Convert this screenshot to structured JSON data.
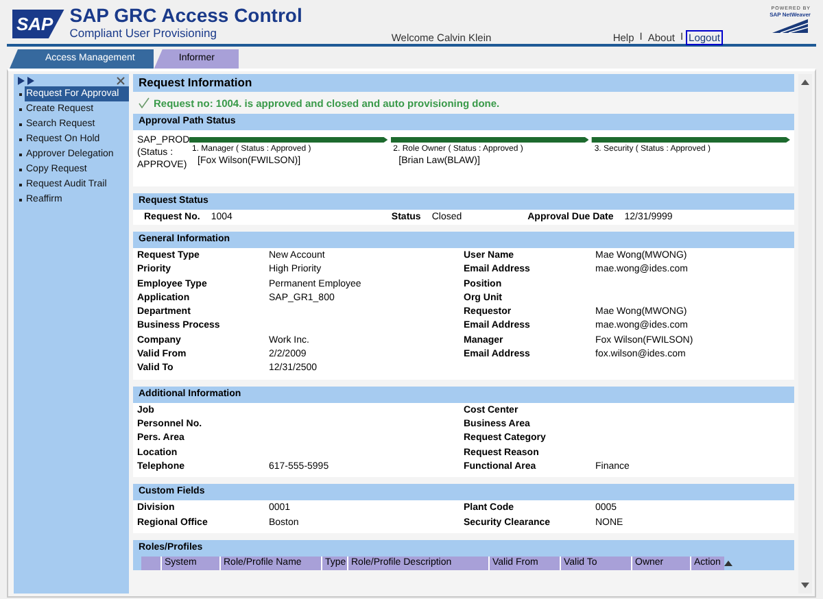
{
  "header": {
    "logo": "SAP",
    "title": "SAP GRC Access Control",
    "subtitle": "Compliant User Provisioning",
    "welcome": "Welcome Calvin Klein",
    "links": [
      {
        "label": "Help",
        "focused": false
      },
      {
        "label": "About",
        "focused": false
      },
      {
        "label": "Logout",
        "focused": true
      }
    ],
    "link_separators": [
      "I",
      "I"
    ],
    "powered_by": "POWERED BY",
    "powered_brand": "SAP NetWeaver"
  },
  "tabs": [
    {
      "label": "Access Management",
      "selected": true
    },
    {
      "label": "Informer",
      "selected": false
    }
  ],
  "sidebar": {
    "items": [
      {
        "label": "Request For Approval",
        "selected": true
      },
      {
        "label": "Create Request",
        "selected": false
      },
      {
        "label": "Search Request",
        "selected": false
      },
      {
        "label": "Request On Hold",
        "selected": false
      },
      {
        "label": "Approver Delegation",
        "selected": false
      },
      {
        "label": "Copy Request",
        "selected": false
      },
      {
        "label": "Request Audit Trail",
        "selected": false
      },
      {
        "label": "Reaffirm",
        "selected": false
      }
    ]
  },
  "request_information": {
    "title": "Request Information",
    "message": "Request no: 1004. is approved and closed and auto provisioning done."
  },
  "approval_path": {
    "title": "Approval Path Status",
    "system": "SAP_PROD (Status : APPROVE)",
    "stages": [
      {
        "label": "1. Manager ( Status : Approved )",
        "approver": "[Fox Wilson(FWILSON)]",
        "approved": true
      },
      {
        "label": "2. Role Owner ( Status : Approved )",
        "approver": "[Brian Law(BLAW)]",
        "approved": true
      },
      {
        "label": "3. Security ( Status : Approved )",
        "approved": true
      }
    ]
  },
  "request_status": {
    "title": "Request Status",
    "fields": [
      {
        "label": "Request No.",
        "value": "1004"
      },
      {
        "label": "Status",
        "value": "Closed"
      },
      {
        "label": "Approval Due Date",
        "value": "12/31/9999"
      }
    ]
  },
  "general_information": {
    "title": "General Information",
    "left": [
      {
        "label": "Request Type",
        "value": "New Account"
      },
      {
        "label": "Priority",
        "value": "High Priority"
      },
      {
        "label": "Employee Type",
        "value": "Permanent Employee"
      },
      {
        "label": "Application",
        "value": "SAP_GR1_800"
      },
      {
        "label": "Department"
      },
      {
        "label": "Business Process"
      },
      {
        "label": "Company",
        "value": "Work Inc."
      },
      {
        "label": "Valid From",
        "value": "2/2/2009"
      },
      {
        "label": "Valid To",
        "value": "12/31/2500"
      }
    ],
    "right": [
      {
        "label": "User Name",
        "value": "Mae Wong(MWONG)"
      },
      {
        "label": "Email Address",
        "value": "mae.wong@ides.com"
      },
      {
        "label": "Position"
      },
      {
        "label": "Org Unit"
      },
      {
        "label": "Requestor",
        "value": "Mae Wong(MWONG)"
      },
      {
        "label": "Email Address",
        "value": "mae.wong@ides.com"
      },
      {
        "label": "Manager",
        "value": "Fox Wilson(FWILSON)"
      },
      {
        "label": "Email Address",
        "value": "fox.wilson@ides.com"
      }
    ]
  },
  "additional_information": {
    "title": "Additional Information",
    "left": [
      {
        "label": "Job"
      },
      {
        "label": "Personnel No."
      },
      {
        "label": "Pers. Area"
      },
      {
        "label": "Location"
      },
      {
        "label": "Telephone",
        "value": "617-555-5995"
      }
    ],
    "right": [
      {
        "label": "Cost Center"
      },
      {
        "label": "Business Area"
      },
      {
        "label": "Request Category"
      },
      {
        "label": "Request Reason"
      },
      {
        "label": "Functional Area",
        "value": "Finance"
      }
    ]
  },
  "custom_fields": {
    "title": "Custom Fields",
    "left": [
      {
        "label": "Division",
        "value": "0001"
      },
      {
        "label": "Regional Office",
        "value": "Boston"
      }
    ],
    "right": [
      {
        "label": "Plant Code",
        "value": "0005"
      },
      {
        "label": "Security Clearance",
        "value": "NONE"
      }
    ]
  },
  "roles_profiles": {
    "title": "Roles/Profiles",
    "columns": [
      "System",
      "Role/Profile Name",
      "Type",
      "Role/Profile Description",
      "Valid From",
      "Valid To",
      "Owner",
      "Action"
    ]
  }
}
